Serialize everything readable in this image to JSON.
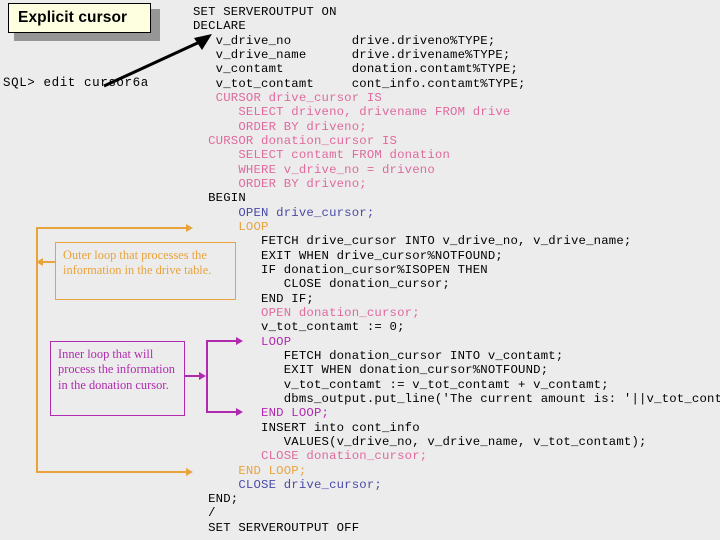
{
  "title_callout": {
    "label": "Explicit cursor"
  },
  "terminal": {
    "prompt_line": "SQL> edit cursor6a"
  },
  "code": {
    "language": "PL/SQL",
    "lines": [
      [
        {
          "t": "SET SERVEROUTPUT ON",
          "c": "black"
        }
      ],
      [
        {
          "t": "DECLARE",
          "c": "black"
        }
      ],
      [
        {
          "t": "   v_drive_no        drive.driveno%TYPE;",
          "c": "black"
        }
      ],
      [
        {
          "t": "   v_drive_name      drive.drivename%TYPE;",
          "c": "black"
        }
      ],
      [
        {
          "t": "   v_contamt         donation.contamt%TYPE;",
          "c": "black"
        }
      ],
      [
        {
          "t": "   v_tot_contamt     cont_info.contamt%TYPE;",
          "c": "black"
        }
      ],
      [
        {
          "t": "   CURSOR drive_cursor IS",
          "c": "pink"
        }
      ],
      [
        {
          "t": "      SELECT driveno, drivename FROM drive",
          "c": "pink"
        }
      ],
      [
        {
          "t": "      ORDER BY driveno;",
          "c": "pink"
        }
      ],
      [
        {
          "t": "  CURSOR donation_cursor IS",
          "c": "pink"
        }
      ],
      [
        {
          "t": "      SELECT contamt FROM donation",
          "c": "pink"
        }
      ],
      [
        {
          "t": "      WHERE v_drive_no = driveno",
          "c": "pink"
        }
      ],
      [
        {
          "t": "      ORDER BY driveno;",
          "c": "pink"
        }
      ],
      [
        {
          "t": "  BEGIN",
          "c": "black"
        }
      ],
      [
        {
          "t": "      OPEN drive_cursor;",
          "c": "blue"
        }
      ],
      [
        {
          "t": "      LOOP",
          "c": "orange"
        }
      ],
      [
        {
          "t": "         FETCH drive_cursor INTO v_drive_no, v_drive_name;",
          "c": "black"
        }
      ],
      [
        {
          "t": "         EXIT WHEN drive_cursor%NOTFOUND;",
          "c": "black"
        }
      ],
      [
        {
          "t": "         IF donation_cursor%ISOPEN THEN",
          "c": "black"
        }
      ],
      [
        {
          "t": "            CLOSE donation_cursor;",
          "c": "black"
        }
      ],
      [
        {
          "t": "         END IF;",
          "c": "black"
        }
      ],
      [
        {
          "t": "         OPEN donation_cursor;",
          "c": "pink"
        }
      ],
      [
        {
          "t": "         v_tot_contamt := 0;",
          "c": "black"
        }
      ],
      [
        {
          "t": "         LOOP",
          "c": "purple"
        }
      ],
      [
        {
          "t": "            FETCH donation_cursor INTO v_contamt;",
          "c": "black"
        }
      ],
      [
        {
          "t": "            EXIT WHEN donation_cursor%NOTFOUND;",
          "c": "black"
        }
      ],
      [
        {
          "t": "            v_tot_contamt := v_tot_contamt + v_contamt;",
          "c": "black"
        }
      ],
      [
        {
          "t": "            dbms_output.put_line('The current amount is: '||v_tot_contamt);",
          "c": "black"
        }
      ],
      [
        {
          "t": "         END LOOP;",
          "c": "purple"
        }
      ],
      [
        {
          "t": "         INSERT into cont_info",
          "c": "black"
        }
      ],
      [
        {
          "t": "            VALUES(v_drive_no, v_drive_name, v_tot_contamt);",
          "c": "black"
        }
      ],
      [
        {
          "t": "         CLOSE donation_cursor;",
          "c": "pink"
        }
      ],
      [
        {
          "t": "      END LOOP;",
          "c": "orange"
        }
      ],
      [
        {
          "t": "      CLOSE drive_cursor;",
          "c": "blue"
        }
      ],
      [
        {
          "t": "  END;",
          "c": "black"
        }
      ],
      [
        {
          "t": "  /",
          "c": "black"
        }
      ],
      [
        {
          "t": "  SET SERVEROUTPUT OFF",
          "c": "black"
        }
      ]
    ]
  },
  "annotations": {
    "outer_loop_note": "Outer loop that processes the information in the drive table.",
    "inner_loop_note": "Inner loop that will process the information in the donation cursor."
  },
  "colors": {
    "background": "#ececec",
    "title_fill": "#feffe1",
    "title_shadow": "#969696",
    "orange": "#e8a33d",
    "purple": "#b02ab0",
    "pink": "#e06a9e",
    "blue": "#4a4aa8",
    "black": "#000000"
  }
}
